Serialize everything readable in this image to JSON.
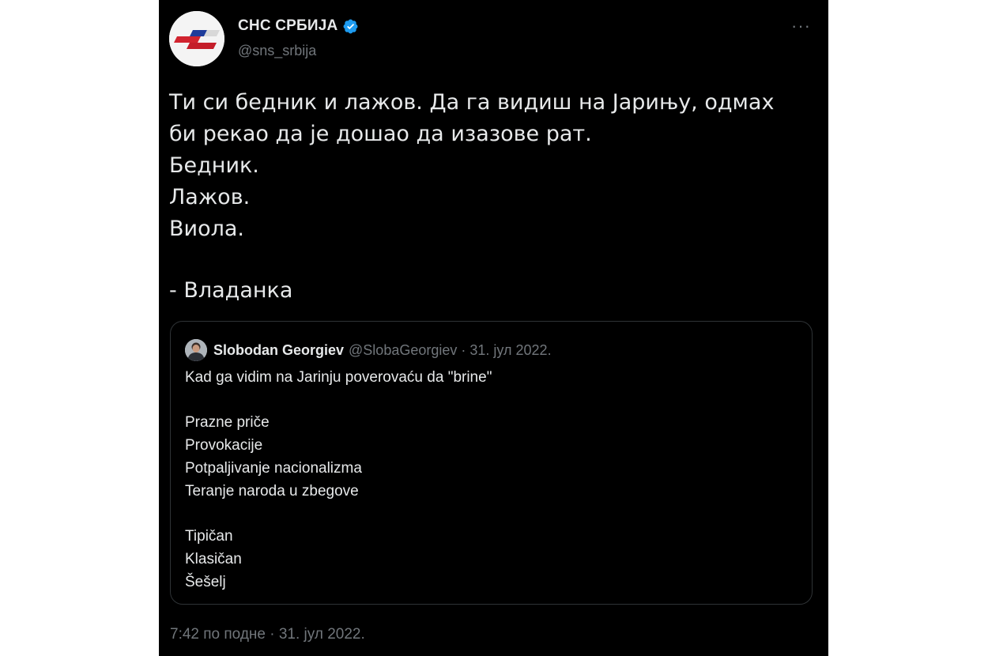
{
  "colors": {
    "background": "#000000",
    "text_primary": "#e7e9ea",
    "text_secondary": "#71767b",
    "verified_blue": "#1d9bf0",
    "border": "#2f3336"
  },
  "tweet": {
    "author": {
      "display_name": "СНС СРБИЈА",
      "handle": "@sns_srbija",
      "verified": true,
      "avatar_icon": "sns-logo-icon"
    },
    "more_label": "···",
    "text_lines": [
      "Ти си бедник и лажов. Да га видиш на Јарињу, одмах",
      "би рекао да је дошао да изазове рат.",
      "Бедник.",
      "Лажов.",
      "Виола.",
      "",
      "- Владанка"
    ],
    "quoted": {
      "display_name": "Slobodan Georgiev",
      "handle": "@SlobaGeorgiev",
      "separator": "·",
      "date": "31. јул 2022.",
      "avatar_icon": "user-avatar-icon",
      "text_lines": [
        "Kad ga vidim na Jarinju poverovaću da \"brine\"",
        "",
        "Prazne priče",
        "Provokacije",
        "Potpaljivanje nacionalizma",
        "Teranje naroda u zbegove",
        "",
        "Tipičan",
        "Klasičan",
        "Šešelj"
      ]
    },
    "timestamp": "7:42 по подне · 31. јул 2022."
  }
}
